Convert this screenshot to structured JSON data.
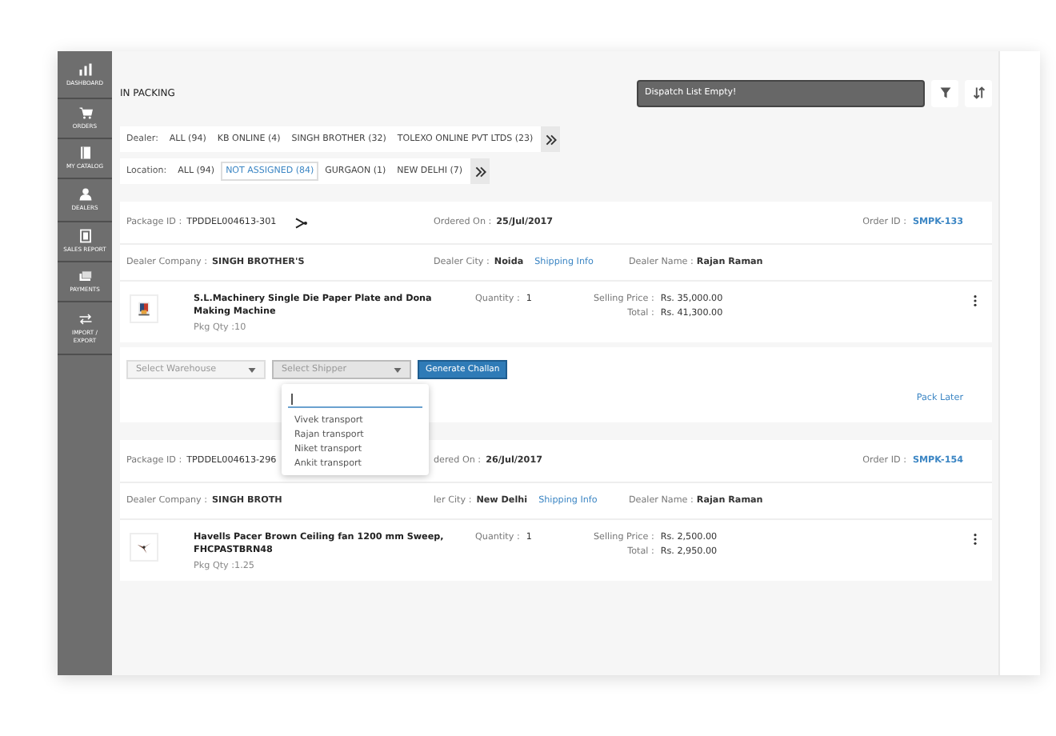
{
  "sidebar": {
    "items": [
      {
        "label": "DASHBOARD"
      },
      {
        "label": "ORDERS"
      },
      {
        "label": "MY CATALOG"
      },
      {
        "label": "DEALERS"
      },
      {
        "label": "SALES REPORT"
      },
      {
        "label": "PAYMENTS"
      },
      {
        "label": "IMPORT / EXPORT"
      }
    ]
  },
  "header": {
    "title": "IN PACKING",
    "dispatch_field": {
      "value": "Dispatch List Empty!"
    }
  },
  "dealer_filter": {
    "label": "Dealer:",
    "options": [
      {
        "label": "ALL (94)",
        "selected": false
      },
      {
        "label": "KB ONLINE (4)",
        "selected": false
      },
      {
        "label": "SINGH BROTHER (32)",
        "selected": false
      },
      {
        "label": "TOLEXO ONLINE PVT LTDS (23)",
        "selected": false
      }
    ]
  },
  "location_filter": {
    "label": "Location:",
    "options": [
      {
        "label": "ALL (94)",
        "selected": false
      },
      {
        "label": "NOT ASSIGNED (84)",
        "selected": true
      },
      {
        "label": "GURGAON (1)",
        "selected": false
      },
      {
        "label": "NEW DELHI (7)",
        "selected": false
      }
    ]
  },
  "packages": [
    {
      "package_id_label": "Package ID :",
      "package_id": "TPDDEL004613-301",
      "show_scissors": true,
      "ordered_on_label": "Ordered On :",
      "ordered_on": "25/Jul/2017",
      "order_id_label": "Order ID :",
      "order_id": "SMPK-133",
      "dealer_company_label": "Dealer Company :",
      "dealer_company": "SINGH BROTHER'S",
      "dealer_city_label": "Dealer City :",
      "dealer_city": "Noida",
      "shipping_link": "Shipping Info",
      "dealer_name_label": "Dealer Name :",
      "dealer_name": "Rajan Raman",
      "product": {
        "name": "S.L.Machinery Single Die Paper Plate and Dona Making Machine",
        "pkg_qty": "Pkg Qty :10",
        "quantity_label": "Quantity :",
        "quantity": "1",
        "price_label": "Selling Price :",
        "price": "Rs. 35,000.00",
        "total_label": "Total :",
        "total": "Rs. 41,300.00"
      },
      "actions": {
        "warehouse_placeholder": "Select Warehouse",
        "shipper_placeholder": "Select Shipper",
        "generate_button": "Generate Challan",
        "pack_later": "Pack Later",
        "shipper_dropdown": {
          "options": [
            "Vivek transport",
            "Rajan transport",
            "Niket transport",
            "Ankit transport"
          ]
        }
      }
    },
    {
      "package_id_label": "Package ID :",
      "package_id": "TPDDEL004613-296",
      "show_scissors": false,
      "ordered_on_label": "dered On :",
      "ordered_on": "26/Jul/2017",
      "order_id_label": "Order ID :",
      "order_id": "SMPK-154",
      "dealer_company_label": "Dealer Company :",
      "dealer_company": "SINGH BROTH",
      "dealer_city_label": "ler City :",
      "dealer_city": "New Delhi",
      "shipping_link": "Shipping Info",
      "dealer_name_label": "Dealer Name :",
      "dealer_name": "Rajan Raman",
      "product": {
        "name": "Havells Pacer Brown Ceiling fan 1200 mm Sweep, FHCPASTBRN48",
        "pkg_qty": "Pkg Qty :1.25",
        "quantity_label": "Quantity :",
        "quantity": "1",
        "price_label": "Selling Price :",
        "price": "Rs. 2,500.00",
        "total_label": "Total :",
        "total": "Rs. 2,950.00"
      }
    }
  ]
}
